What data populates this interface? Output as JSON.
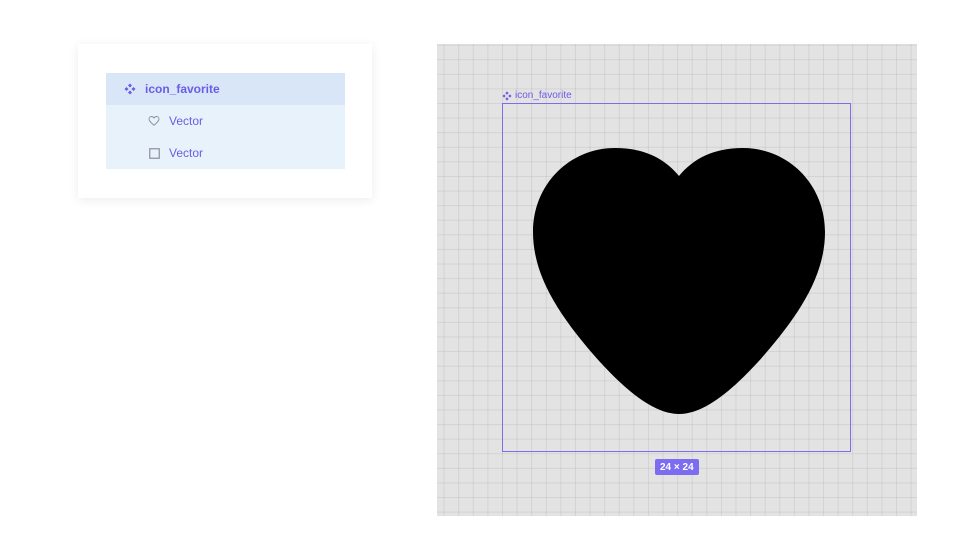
{
  "layers": {
    "items": [
      {
        "label": "icon_favorite",
        "icon": "component-icon",
        "kind": "component"
      },
      {
        "label": "Vector",
        "icon": "heart-outline-icon",
        "kind": "vector"
      },
      {
        "label": "Vector",
        "icon": "rectangle-icon",
        "kind": "vector"
      }
    ]
  },
  "canvas": {
    "frame_label": "icon_favorite",
    "size_badge": "24 × 24"
  },
  "colors": {
    "accent": "#6b5ce7",
    "selection_bg": "#d8e6f8",
    "child_bg": "#e8f2fb",
    "canvas_bg": "#e3e3e3",
    "heart_fill": "#000000"
  }
}
